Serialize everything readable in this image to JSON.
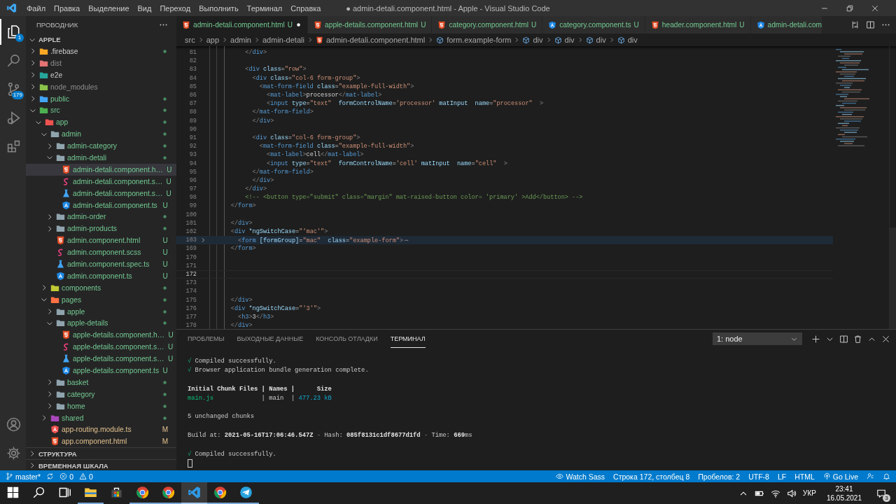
{
  "title_bar": {
    "menu": [
      "Файл",
      "Правка",
      "Выделение",
      "Вид",
      "Переход",
      "Выполнить",
      "Терминал",
      "Справка"
    ],
    "title": "● admin-detali.component.html - Apple - Visual Studio Code"
  },
  "activity_bar": {
    "top": [
      {
        "kind": "explorer",
        "selected": true,
        "badge": "1"
      },
      {
        "kind": "search",
        "selected": false
      },
      {
        "kind": "scm",
        "selected": false,
        "badge": "179"
      },
      {
        "kind": "run",
        "selected": false
      },
      {
        "kind": "extensions",
        "selected": false
      }
    ],
    "bottom": [
      {
        "kind": "account",
        "selected": false
      },
      {
        "kind": "settings",
        "selected": false
      }
    ]
  },
  "sidebar": {
    "title": "ПРОВОДНИК",
    "folder": {
      "label": "APPLE",
      "expanded": true
    },
    "tree": [
      {
        "label": ".firebase",
        "kind": "folder",
        "color": "#f9a825",
        "untracked": false,
        "modified": false,
        "ignored": false,
        "expanded": false,
        "dot": true,
        "selected": false
      },
      {
        "label": "dist",
        "kind": "folder",
        "color": "#e57373",
        "untracked": false,
        "modified": false,
        "ignored": true,
        "expanded": false,
        "selected": false
      },
      {
        "label": "e2e",
        "kind": "folder",
        "color": "#26a69a",
        "untracked": false,
        "modified": false,
        "ignored": false,
        "expanded": false,
        "selected": false
      },
      {
        "label": "node_modules",
        "kind": "folder",
        "color": "#8bc34a",
        "untracked": false,
        "modified": false,
        "ignored": true,
        "expanded": false,
        "selected": false
      },
      {
        "label": "public",
        "kind": "folder",
        "color": "#42a5f5",
        "untracked": true,
        "modified": false,
        "ignored": false,
        "expanded": false,
        "dot": true,
        "selected": false
      },
      {
        "label": "src",
        "kind": "folder",
        "color": "#4caf50",
        "untracked": true,
        "modified": false,
        "ignored": false,
        "expanded": true,
        "dot": true,
        "selected": false,
        "children": [
          {
            "label": "app",
            "kind": "folder",
            "color": "#ef5350",
            "untracked": true,
            "modified": false,
            "ignored": false,
            "expanded": true,
            "dot": true,
            "selected": false,
            "children": [
              {
                "label": "admin",
                "kind": "folder",
                "color": "#90a4ae",
                "untracked": true,
                "modified": false,
                "ignored": false,
                "expanded": true,
                "dot": true,
                "selected": false,
                "children": [
                  {
                    "label": "admin-category",
                    "kind": "folder",
                    "color": "#90a4ae",
                    "untracked": true,
                    "modified": false,
                    "ignored": false,
                    "expanded": false,
                    "dot": true,
                    "selected": false
                  },
                  {
                    "label": "admin-detali",
                    "kind": "folder",
                    "color": "#90a4ae",
                    "untracked": true,
                    "modified": false,
                    "ignored": false,
                    "expanded": true,
                    "dot": true,
                    "selected": false,
                    "children": [
                      {
                        "label": "admin-detali.component.h…",
                        "kind": "html",
                        "color": "#e44d26",
                        "untracked": true,
                        "modified": false,
                        "ignored": false,
                        "badge": "U",
                        "selected": true
                      },
                      {
                        "label": "admin-detali.component.s…",
                        "kind": "scss",
                        "color": "#ec407a",
                        "untracked": true,
                        "modified": false,
                        "ignored": false,
                        "badge": "U",
                        "selected": false
                      },
                      {
                        "label": "admin-detali.component.s…",
                        "kind": "spec",
                        "color": "#42a5f5",
                        "untracked": true,
                        "modified": false,
                        "ignored": false,
                        "badge": "U",
                        "selected": false
                      },
                      {
                        "label": "admin-detali.component.ts",
                        "kind": "angular",
                        "color": "#1e88e5",
                        "untracked": true,
                        "modified": false,
                        "ignored": false,
                        "badge": "U",
                        "selected": false
                      }
                    ]
                  },
                  {
                    "label": "admin-order",
                    "kind": "folder",
                    "color": "#90a4ae",
                    "untracked": true,
                    "modified": false,
                    "ignored": false,
                    "expanded": false,
                    "dot": true,
                    "selected": false
                  },
                  {
                    "label": "admin-products",
                    "kind": "folder",
                    "color": "#90a4ae",
                    "untracked": true,
                    "modified": false,
                    "ignored": false,
                    "expanded": false,
                    "dot": true,
                    "selected": false
                  },
                  {
                    "label": "admin.component.html",
                    "kind": "html",
                    "color": "#e44d26",
                    "untracked": true,
                    "modified": false,
                    "ignored": false,
                    "badge": "U",
                    "selected": false
                  },
                  {
                    "label": "admin.component.scss",
                    "kind": "scss",
                    "color": "#ec407a",
                    "untracked": true,
                    "modified": false,
                    "ignored": false,
                    "badge": "U",
                    "selected": false
                  },
                  {
                    "label": "admin.component.spec.ts",
                    "kind": "spec",
                    "color": "#42a5f5",
                    "untracked": true,
                    "modified": false,
                    "ignored": false,
                    "badge": "U",
                    "selected": false
                  },
                  {
                    "label": "admin.component.ts",
                    "kind": "angular",
                    "color": "#1e88e5",
                    "untracked": true,
                    "modified": false,
                    "ignored": false,
                    "badge": "U",
                    "selected": false
                  }
                ]
              },
              {
                "label": "components",
                "kind": "folder",
                "color": "#c0ca33",
                "untracked": true,
                "modified": false,
                "ignored": false,
                "expanded": false,
                "dot": true,
                "selected": false
              },
              {
                "label": "pages",
                "kind": "folder",
                "color": "#ff7043",
                "untracked": true,
                "modified": false,
                "ignored": false,
                "expanded": true,
                "dot": true,
                "selected": false,
                "children": [
                  {
                    "label": "apple",
                    "kind": "folder",
                    "color": "#90a4ae",
                    "untracked": true,
                    "modified": false,
                    "ignored": false,
                    "expanded": false,
                    "dot": true,
                    "selected": false
                  },
                  {
                    "label": "apple-details",
                    "kind": "folder",
                    "color": "#90a4ae",
                    "untracked": true,
                    "modified": false,
                    "ignored": false,
                    "expanded": true,
                    "dot": true,
                    "selected": false,
                    "children": [
                      {
                        "label": "apple-details.component.h…",
                        "kind": "html",
                        "color": "#e44d26",
                        "untracked": true,
                        "modified": false,
                        "ignored": false,
                        "badge": "U",
                        "selected": false
                      },
                      {
                        "label": "apple-details.component.s…",
                        "kind": "scss",
                        "color": "#ec407a",
                        "untracked": true,
                        "modified": false,
                        "ignored": false,
                        "badge": "U",
                        "selected": false
                      },
                      {
                        "label": "apple-details.component.s…",
                        "kind": "spec",
                        "color": "#42a5f5",
                        "untracked": true,
                        "modified": false,
                        "ignored": false,
                        "badge": "U",
                        "selected": false
                      },
                      {
                        "label": "apple-details.component.ts",
                        "kind": "angular",
                        "color": "#1e88e5",
                        "untracked": true,
                        "modified": false,
                        "ignored": false,
                        "badge": "U",
                        "selected": false
                      }
                    ]
                  },
                  {
                    "label": "basket",
                    "kind": "folder",
                    "color": "#90a4ae",
                    "untracked": true,
                    "modified": false,
                    "ignored": false,
                    "expanded": false,
                    "dot": true,
                    "selected": false
                  },
                  {
                    "label": "category",
                    "kind": "folder",
                    "color": "#90a4ae",
                    "untracked": true,
                    "modified": false,
                    "ignored": false,
                    "expanded": false,
                    "dot": true,
                    "selected": false
                  },
                  {
                    "label": "home",
                    "kind": "folder",
                    "color": "#90a4ae",
                    "untracked": true,
                    "modified": false,
                    "ignored": false,
                    "expanded": false,
                    "dot": true,
                    "selected": false
                  }
                ]
              },
              {
                "label": "shared",
                "kind": "folder",
                "color": "#ab47bc",
                "untracked": true,
                "modified": false,
                "ignored": false,
                "expanded": false,
                "dot": true,
                "selected": false
              },
              {
                "label": "app-routing.module.ts",
                "kind": "angular",
                "color": "#ef5350",
                "untracked": false,
                "modified": true,
                "ignored": false,
                "badge": "M",
                "selected": false
              },
              {
                "label": "app.component.html",
                "kind": "html",
                "color": "#e44d26",
                "untracked": false,
                "modified": true,
                "ignored": false,
                "badge": "M",
                "selected": false
              }
            ]
          }
        ]
      }
    ],
    "sections": [
      {
        "label": "СТРУКТУРА",
        "expanded": false
      },
      {
        "label": "ВРЕМЕННАЯ ШКАЛА",
        "expanded": false
      }
    ]
  },
  "editor": {
    "tabs": [
      {
        "label": "admin-detali.component.html",
        "kind": "html",
        "badge": "U",
        "selected": true,
        "dirty": true
      },
      {
        "label": "apple-details.component.html",
        "kind": "html",
        "badge": "U",
        "selected": false,
        "dirty": false
      },
      {
        "label": "category.component.html",
        "kind": "html",
        "badge": "U",
        "selected": false,
        "dirty": false
      },
      {
        "label": "category.component.ts",
        "kind": "angular",
        "badge": "U",
        "selected": false,
        "dirty": false
      },
      {
        "label": "header.component.html",
        "kind": "html",
        "badge": "U",
        "selected": false,
        "dirty": false
      },
      {
        "label": "admin-detali.com",
        "kind": "angular",
        "selected": false,
        "dirty": false
      }
    ],
    "breadcrumbs": [
      {
        "kind": "folder",
        "text": "src"
      },
      {
        "kind": "folder",
        "text": "app"
      },
      {
        "kind": "folder",
        "text": "admin"
      },
      {
        "kind": "folder",
        "text": "admin-detali"
      },
      {
        "kind": "html",
        "text": "admin-detali.component.html"
      },
      {
        "kind": "element",
        "text": "form.example-form"
      },
      {
        "kind": "element",
        "text": "div"
      },
      {
        "kind": "element",
        "text": "div"
      },
      {
        "kind": "element",
        "text": "div"
      },
      {
        "kind": "element",
        "text": "div"
      }
    ],
    "lines": [
      {
        "number": "81",
        "current": false,
        "folded": false,
        "tokens": [
          {
            "kind": "punct",
            "text": "          </"
          },
          {
            "kind": "tag",
            "text": "div"
          },
          {
            "kind": "punct",
            "text": ">"
          }
        ]
      },
      {
        "number": "82",
        "current": false,
        "folded": false
      },
      {
        "number": "83",
        "current": false,
        "folded": false,
        "tokens": [
          {
            "kind": "punct",
            "text": "          <"
          },
          {
            "kind": "tag",
            "text": "div"
          },
          {
            "kind": "attr",
            "text": " class"
          },
          {
            "kind": "op",
            "text": "="
          },
          {
            "kind": "str",
            "text": "\"row\""
          },
          {
            "kind": "punct",
            "text": ">"
          }
        ]
      },
      {
        "number": "84",
        "current": false,
        "folded": false,
        "tokens": [
          {
            "kind": "punct",
            "text": "            <"
          },
          {
            "kind": "tag",
            "text": "div"
          },
          {
            "kind": "attr",
            "text": " class"
          },
          {
            "kind": "op",
            "text": "="
          },
          {
            "kind": "str",
            "text": "\"col-6 form-group\""
          },
          {
            "kind": "punct",
            "text": ">"
          }
        ]
      },
      {
        "number": "85",
        "current": false,
        "folded": false,
        "tokens": [
          {
            "kind": "punct",
            "text": "              <"
          },
          {
            "kind": "tag",
            "text": "mat-form-field"
          },
          {
            "kind": "attr",
            "text": " class"
          },
          {
            "kind": "op",
            "text": "="
          },
          {
            "kind": "str",
            "text": "\"example-full-width\""
          },
          {
            "kind": "punct",
            "text": ">"
          }
        ]
      },
      {
        "number": "86",
        "current": false,
        "folded": false,
        "tokens": [
          {
            "kind": "punct",
            "text": "                <"
          },
          {
            "kind": "tag",
            "text": "mat-label"
          },
          {
            "kind": "punct",
            "text": ">"
          },
          {
            "kind": "text",
            "text": "processor"
          },
          {
            "kind": "punct",
            "text": "</"
          },
          {
            "kind": "tag",
            "text": "mat-label"
          },
          {
            "kind": "punct",
            "text": ">"
          }
        ]
      },
      {
        "number": "87",
        "current": false,
        "folded": false,
        "tokens": [
          {
            "kind": "punct",
            "text": "                <"
          },
          {
            "kind": "tag",
            "text": "input"
          },
          {
            "kind": "attr",
            "text": " type"
          },
          {
            "kind": "op",
            "text": "="
          },
          {
            "kind": "str",
            "text": "\"text\""
          },
          {
            "kind": "attr",
            "text": "  formControlName"
          },
          {
            "kind": "op",
            "text": "="
          },
          {
            "kind": "str",
            "text": "'processor'"
          },
          {
            "kind": "attr",
            "text": " matInput  name"
          },
          {
            "kind": "op",
            "text": "="
          },
          {
            "kind": "str",
            "text": "\"processor\""
          },
          {
            "kind": "punct",
            "text": "  >"
          }
        ]
      },
      {
        "number": "88",
        "current": false,
        "folded": false,
        "tokens": [
          {
            "kind": "punct",
            "text": "            </"
          },
          {
            "kind": "tag",
            "text": "mat-form-field"
          },
          {
            "kind": "punct",
            "text": ">"
          }
        ]
      },
      {
        "number": "89",
        "current": false,
        "folded": false,
        "tokens": [
          {
            "kind": "punct",
            "text": "            </"
          },
          {
            "kind": "tag",
            "text": "div"
          },
          {
            "kind": "punct",
            "text": ">"
          }
        ]
      },
      {
        "number": "90",
        "current": false,
        "folded": false
      },
      {
        "number": "91",
        "current": false,
        "folded": false,
        "tokens": [
          {
            "kind": "punct",
            "text": "            <"
          },
          {
            "kind": "tag",
            "text": "div"
          },
          {
            "kind": "attr",
            "text": " class"
          },
          {
            "kind": "op",
            "text": "="
          },
          {
            "kind": "str",
            "text": "\"col-6 form-group\""
          },
          {
            "kind": "punct",
            "text": ">"
          }
        ]
      },
      {
        "number": "92",
        "current": false,
        "folded": false,
        "tokens": [
          {
            "kind": "punct",
            "text": "              <"
          },
          {
            "kind": "tag",
            "text": "mat-form-field"
          },
          {
            "kind": "attr",
            "text": " class"
          },
          {
            "kind": "op",
            "text": "="
          },
          {
            "kind": "str",
            "text": "\"example-full-width\""
          },
          {
            "kind": "punct",
            "text": ">"
          }
        ]
      },
      {
        "number": "93",
        "current": false,
        "folded": false,
        "tokens": [
          {
            "kind": "punct",
            "text": "                <"
          },
          {
            "kind": "tag",
            "text": "mat-label"
          },
          {
            "kind": "punct",
            "text": ">"
          },
          {
            "kind": "text",
            "text": "cell"
          },
          {
            "kind": "punct",
            "text": "</"
          },
          {
            "kind": "tag",
            "text": "mat-label"
          },
          {
            "kind": "punct",
            "text": ">"
          }
        ]
      },
      {
        "number": "94",
        "current": false,
        "folded": false,
        "tokens": [
          {
            "kind": "punct",
            "text": "                <"
          },
          {
            "kind": "tag",
            "text": "input"
          },
          {
            "kind": "attr",
            "text": " type"
          },
          {
            "kind": "op",
            "text": "="
          },
          {
            "kind": "str",
            "text": "\"text\""
          },
          {
            "kind": "attr",
            "text": "  formControlName"
          },
          {
            "kind": "op",
            "text": "="
          },
          {
            "kind": "str",
            "text": "'cell'"
          },
          {
            "kind": "attr",
            "text": " matInput  name"
          },
          {
            "kind": "op",
            "text": "="
          },
          {
            "kind": "str",
            "text": "\"cell\""
          },
          {
            "kind": "punct",
            "text": "  >"
          }
        ]
      },
      {
        "number": "95",
        "current": false,
        "folded": false,
        "tokens": [
          {
            "kind": "punct",
            "text": "            </"
          },
          {
            "kind": "tag",
            "text": "mat-form-field"
          },
          {
            "kind": "punct",
            "text": ">"
          }
        ]
      },
      {
        "number": "96",
        "current": false,
        "folded": false,
        "tokens": [
          {
            "kind": "punct",
            "text": "            </"
          },
          {
            "kind": "tag",
            "text": "div"
          },
          {
            "kind": "punct",
            "text": ">"
          }
        ]
      },
      {
        "number": "97",
        "current": false,
        "folded": false,
        "tokens": [
          {
            "kind": "punct",
            "text": "          </"
          },
          {
            "kind": "tag",
            "text": "div"
          },
          {
            "kind": "punct",
            "text": ">"
          }
        ]
      },
      {
        "number": "98",
        "current": false,
        "folded": false,
        "tokens": [
          {
            "kind": "comment",
            "text": "          <!-- <button type=\"submit\" class=\"margin\" mat-raised-button color= 'primary' >Add</button> -->"
          }
        ]
      },
      {
        "number": "99",
        "current": false,
        "folded": false,
        "tokens": [
          {
            "kind": "punct",
            "text": "      </"
          },
          {
            "kind": "tag",
            "text": "form"
          },
          {
            "kind": "punct",
            "text": ">"
          }
        ]
      },
      {
        "number": "100",
        "current": false,
        "folded": false
      },
      {
        "number": "101",
        "current": false,
        "folded": false,
        "tokens": [
          {
            "kind": "punct",
            "text": "      </"
          },
          {
            "kind": "tag",
            "text": "div"
          },
          {
            "kind": "punct",
            "text": ">"
          }
        ]
      },
      {
        "number": "102",
        "current": false,
        "folded": false,
        "tokens": [
          {
            "kind": "punct",
            "text": "      <"
          },
          {
            "kind": "tag",
            "text": "div"
          },
          {
            "kind": "attr",
            "text": " *ngSwitchCase"
          },
          {
            "kind": "op",
            "text": "="
          },
          {
            "kind": "str",
            "text": "\"'mac'\""
          },
          {
            "kind": "punct",
            "text": ">"
          }
        ]
      },
      {
        "number": "103",
        "current": false,
        "folded": true,
        "tokens": [
          {
            "kind": "punct",
            "text": "        <"
          },
          {
            "kind": "tag",
            "text": "form"
          },
          {
            "kind": "attr",
            "text": " [formGroup]"
          },
          {
            "kind": "op",
            "text": "="
          },
          {
            "kind": "str",
            "text": "\"mac\""
          },
          {
            "kind": "attr",
            "text": "  class"
          },
          {
            "kind": "op",
            "text": "="
          },
          {
            "kind": "str",
            "text": "\"example-form\""
          },
          {
            "kind": "punct",
            "text": ">"
          },
          {
            "kind": "fold",
            "text": "⋯"
          }
        ]
      },
      {
        "number": "169",
        "current": false,
        "folded": false,
        "tokens": [
          {
            "kind": "punct",
            "text": "      </"
          },
          {
            "kind": "tag",
            "text": "form"
          },
          {
            "kind": "punct",
            "text": ">"
          }
        ]
      },
      {
        "number": "170",
        "current": false,
        "folded": false
      },
      {
        "number": "171",
        "current": false,
        "folded": false
      },
      {
        "number": "172",
        "current": true,
        "folded": false
      },
      {
        "number": "173",
        "current": false,
        "folded": false
      },
      {
        "number": "174",
        "current": false,
        "folded": false
      },
      {
        "number": "175",
        "current": false,
        "folded": false,
        "tokens": [
          {
            "kind": "punct",
            "text": "      </"
          },
          {
            "kind": "tag",
            "text": "div"
          },
          {
            "kind": "punct",
            "text": ">"
          }
        ]
      },
      {
        "number": "176",
        "current": false,
        "folded": false,
        "tokens": [
          {
            "kind": "punct",
            "text": "      <"
          },
          {
            "kind": "tag",
            "text": "div"
          },
          {
            "kind": "attr",
            "text": " *ngSwitchCase"
          },
          {
            "kind": "op",
            "text": "="
          },
          {
            "kind": "str",
            "text": "\"'3'\""
          },
          {
            "kind": "punct",
            "text": ">"
          }
        ]
      },
      {
        "number": "177",
        "current": false,
        "folded": false,
        "tokens": [
          {
            "kind": "punct",
            "text": "        <"
          },
          {
            "kind": "tag",
            "text": "h3"
          },
          {
            "kind": "punct",
            "text": ">"
          },
          {
            "kind": "text",
            "text": "3"
          },
          {
            "kind": "punct",
            "text": "</"
          },
          {
            "kind": "tag",
            "text": "h3"
          },
          {
            "kind": "punct",
            "text": ">"
          }
        ]
      },
      {
        "number": "178",
        "current": false,
        "folded": false,
        "tokens": [
          {
            "kind": "punct",
            "text": "      </"
          },
          {
            "kind": "tag",
            "text": "div"
          },
          {
            "kind": "punct",
            "text": ">"
          }
        ]
      }
    ]
  },
  "panel": {
    "tabs": [
      {
        "label": "ПРОБЛЕМЫ",
        "selected": false
      },
      {
        "label": "ВЫХОДНЫЕ ДАННЫЕ",
        "selected": false
      },
      {
        "label": "КОНСОЛЬ ОТЛАДКИ",
        "selected": false
      },
      {
        "label": "ТЕРМИНАЛ",
        "selected": true
      }
    ],
    "terminal_select": "1: node",
    "lines": [
      {
        "kind": "text",
        "parts": [
          {
            "kind": "check",
            "text": "√"
          },
          {
            "kind": "plain",
            "text": " Compiled successfully."
          }
        ]
      },
      {
        "kind": "text",
        "parts": [
          {
            "kind": "check",
            "text": "√"
          },
          {
            "kind": "plain",
            "text": " Browser application bundle generation complete."
          }
        ]
      },
      {
        "kind": "blank"
      },
      {
        "kind": "text",
        "parts": [
          {
            "kind": "bold",
            "text": "Initial Chunk Files | Names |      Size"
          }
        ]
      },
      {
        "kind": "text",
        "parts": [
          {
            "kind": "file",
            "text": "main.js"
          },
          {
            "kind": "plain",
            "text": "             | main  | "
          },
          {
            "kind": "size",
            "text": "477.23 kB"
          }
        ]
      },
      {
        "kind": "blank"
      },
      {
        "kind": "text",
        "parts": [
          {
            "kind": "plain",
            "text": "5 unchanged chunks"
          }
        ]
      },
      {
        "kind": "blank"
      },
      {
        "kind": "text",
        "parts": [
          {
            "kind": "plain",
            "text": "Build at: "
          },
          {
            "kind": "bold",
            "text": "2021-05-16T17:06:46.547Z"
          },
          {
            "kind": "dim",
            "text": " - "
          },
          {
            "kind": "plain",
            "text": "Hash: "
          },
          {
            "kind": "bold",
            "text": "085f8131c1df8677d1fd"
          },
          {
            "kind": "dim",
            "text": " - "
          },
          {
            "kind": "plain",
            "text": "Time: "
          },
          {
            "kind": "bold",
            "text": "669"
          },
          {
            "kind": "plain",
            "text": "ms"
          }
        ]
      },
      {
        "kind": "blank"
      },
      {
        "kind": "text",
        "parts": [
          {
            "kind": "check",
            "text": "√"
          },
          {
            "kind": "plain",
            "text": " Compiled successfully."
          }
        ]
      },
      {
        "kind": "cursor"
      }
    ]
  },
  "status_bar": {
    "left": [
      {
        "kind": "branch",
        "text": "master*"
      },
      {
        "kind": "sync"
      },
      {
        "kind": "errors",
        "text": "0"
      },
      {
        "kind": "warnings",
        "text": "0"
      }
    ],
    "right": [
      {
        "kind": "eye",
        "text": "Watch Sass"
      },
      {
        "kind": "text",
        "text": "Строка 172, столбец 8"
      },
      {
        "kind": "text",
        "text": "Пробелов: 2"
      },
      {
        "kind": "text",
        "text": "UTF-8"
      },
      {
        "kind": "text",
        "text": "LF"
      },
      {
        "kind": "text",
        "text": "HTML"
      },
      {
        "kind": "live",
        "text": "Go Live"
      },
      {
        "kind": "feedback"
      },
      {
        "kind": "bell"
      }
    ]
  },
  "taskbar": {
    "apps": [
      {
        "kind": "start",
        "running": false,
        "active": false
      },
      {
        "kind": "search",
        "running": false,
        "active": false
      },
      {
        "kind": "taskview",
        "running": false,
        "active": false
      },
      {
        "kind": "explorer",
        "running": true,
        "active": false
      },
      {
        "kind": "store",
        "running": false,
        "active": false
      },
      {
        "kind": "browser",
        "running": true,
        "active": false
      },
      {
        "kind": "browser",
        "running": true,
        "active": false
      },
      {
        "kind": "editor",
        "running": true,
        "active": true
      },
      {
        "kind": "browser",
        "running": true,
        "active": false
      },
      {
        "kind": "messenger",
        "running": true,
        "active": false
      }
    ],
    "language": "УКР",
    "time": "23:41",
    "date": "16.05.2021",
    "notifications": "3"
  }
}
